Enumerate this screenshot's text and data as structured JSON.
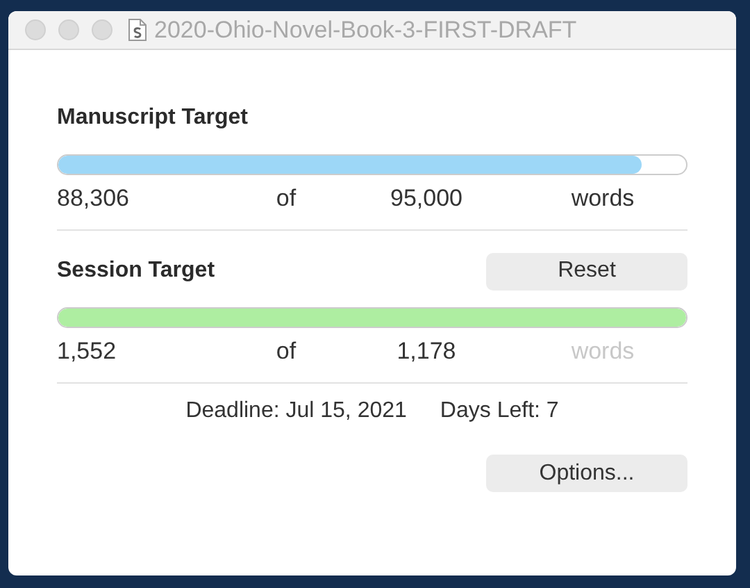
{
  "window": {
    "title": "2020-Ohio-Novel-Book-3-FIRST-DRAFT"
  },
  "targets": [
    {
      "heading": "Manuscript Target",
      "level": 0.93,
      "color": "#9dd7f7",
      "current": "88,306",
      "of": "of",
      "goal": "95,000",
      "unit": "words",
      "unit_disabled": false
    },
    {
      "heading": "Session Target",
      "button": "Reset",
      "level": 1,
      "color": "#aeeea1",
      "current": "1,552",
      "of": "of",
      "goal": "1,178",
      "unit": "words",
      "unit_disabled": true
    }
  ],
  "deadline": {
    "text": "Deadline: Jul 15, 2021",
    "days_left": "Days Left: 7"
  },
  "buttons": [
    "Options..."
  ]
}
